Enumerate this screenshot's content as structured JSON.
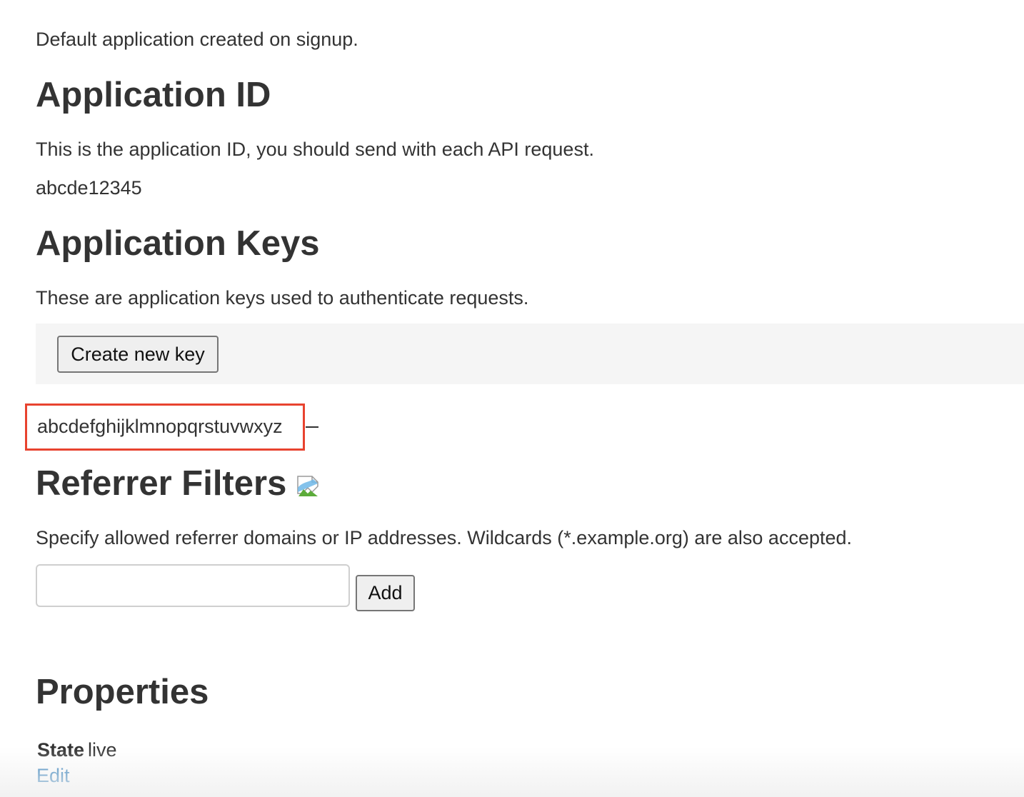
{
  "app": {
    "description": "Default application created on signup."
  },
  "application_id": {
    "heading": "Application ID",
    "description": "This is the application ID, you should send with each API request.",
    "value": "abcde12345"
  },
  "application_keys": {
    "heading": "Application Keys",
    "description": "These are application keys used to authenticate requests.",
    "create_button_label": "Create new key",
    "keys": [
      {
        "value": "abcdefghijklmnopqrstuvwxyz"
      }
    ],
    "highlight_color": "#e8432f"
  },
  "referrer_filters": {
    "heading": "Referrer Filters",
    "heading_icon": "broken-image-icon",
    "description": "Specify allowed referrer domains or IP addresses. Wildcards (*.example.org) are also accepted.",
    "input_value": "",
    "input_placeholder": "",
    "add_button_label": "Add"
  },
  "properties": {
    "heading": "Properties",
    "state_label": "State",
    "state_value": "live",
    "edit_link_label": "Edit",
    "link_color": "#2a7ab8"
  }
}
